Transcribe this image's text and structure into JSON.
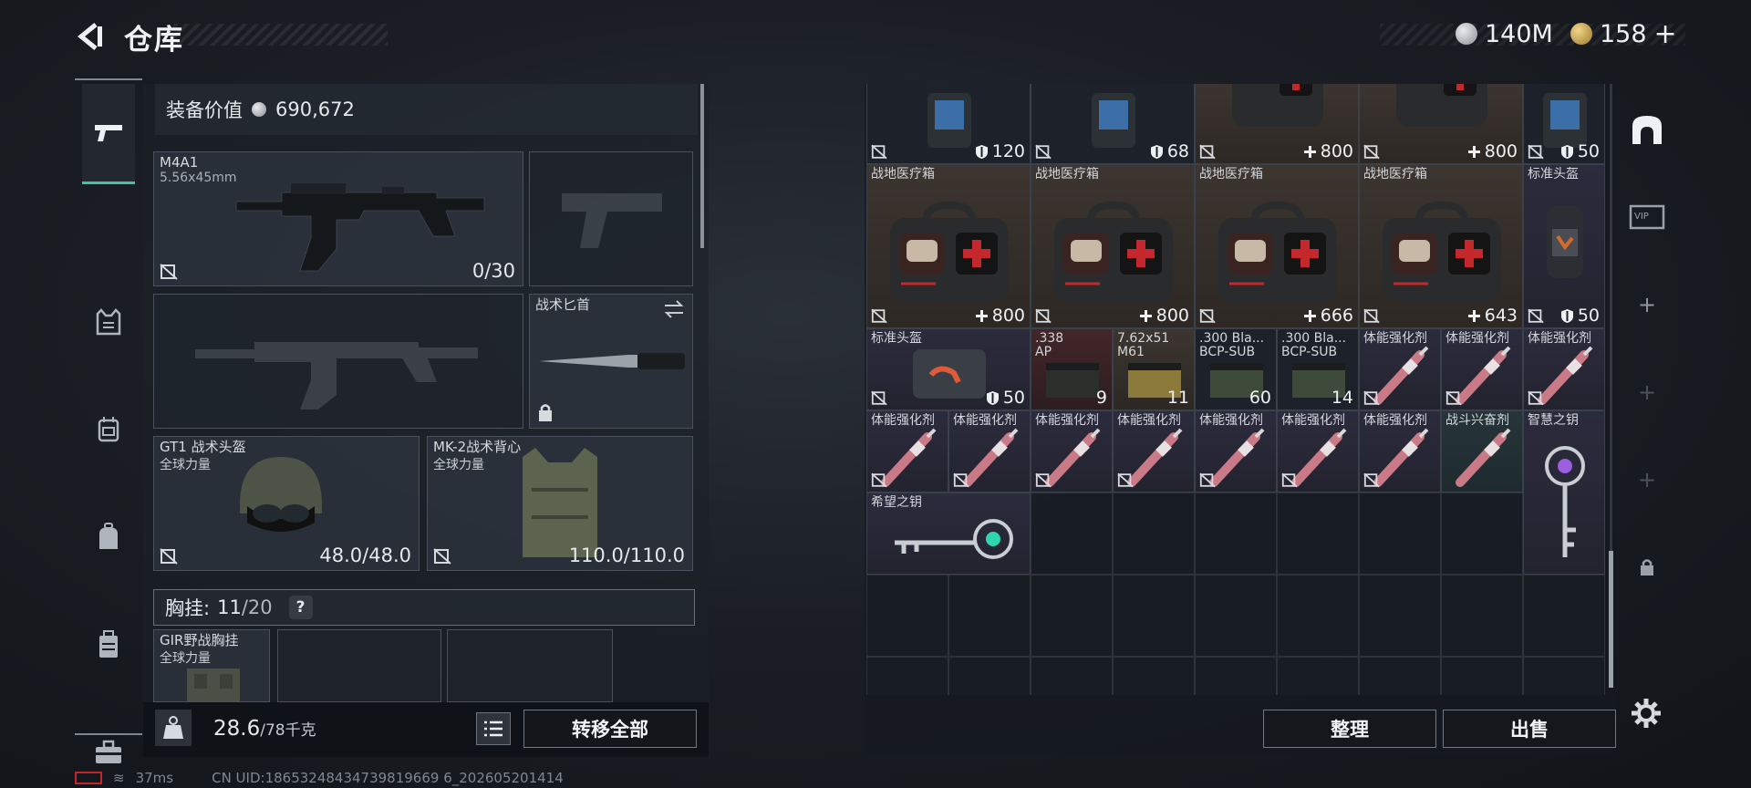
{
  "header": {
    "title": "仓库"
  },
  "currency": {
    "silver": "140M",
    "gold": "158"
  },
  "equip": {
    "value_label": "装备价值",
    "value": "690,672",
    "primary": {
      "name": "M4A1",
      "caliber": "5.56x45mm",
      "ammo": "0/30"
    },
    "melee": {
      "name": "战术匕首"
    },
    "helmet": {
      "name": "GT1 战术头盔",
      "brand": "全球力量",
      "durability": "48.0/48.0"
    },
    "armor": {
      "name": "MK-2战术背心",
      "brand": "全球力量",
      "durability": "110.0/110.0"
    },
    "chest_label": "胸挂:",
    "chest_used": "11",
    "chest_total": "/20",
    "chest_help": "?",
    "rig": {
      "name": "GIR野战胸挂",
      "brand": "全球力量"
    }
  },
  "weight": {
    "current": "28.6",
    "max": "/78千克"
  },
  "buttons": {
    "transfer_all": "转移全部",
    "sort": "整理",
    "sell": "出售"
  },
  "status": {
    "ping": "37ms",
    "uid": "CN UID:18653248434739819669 6_202605201414"
  },
  "stash": {
    "top_row": [
      {
        "value": "120",
        "icon": "armor-icon"
      },
      {
        "value": "68",
        "icon": "armor-icon"
      },
      {
        "value": "800",
        "icon": "plus-icon"
      },
      {
        "value": "800",
        "icon": "plus-icon"
      },
      {
        "value": "50",
        "icon": "armor-icon"
      }
    ],
    "medkits": [
      {
        "name": "战地医疗箱",
        "value": "800"
      },
      {
        "name": "战地医疗箱",
        "value": "800"
      },
      {
        "name": "战地医疗箱",
        "value": "666"
      },
      {
        "name": "战地医疗箱",
        "value": "643"
      }
    ],
    "helmet_tall": {
      "name": "标准头盔",
      "value": "50"
    },
    "row3": [
      {
        "name": "标准头盔",
        "value": "50"
      },
      {
        "name": ".338",
        "name2": "AP",
        "value": "9"
      },
      {
        "name": "7.62x51",
        "name2": "M61",
        "value": "11"
      },
      {
        "name": ".300 Bla...",
        "name2": "BCP-SUB",
        "value": "60"
      },
      {
        "name": ".300 Bla...",
        "name2": "BCP-SUB",
        "value": "14"
      },
      {
        "name": "体能强化剂"
      },
      {
        "name": "体能强化剂"
      },
      {
        "name": "体能强化剂"
      }
    ],
    "row4": [
      {
        "name": "体能强化剂"
      },
      {
        "name": "体能强化剂"
      },
      {
        "name": "体能强化剂"
      },
      {
        "name": "体能强化剂"
      },
      {
        "name": "体能强化剂"
      },
      {
        "name": "体能强化剂"
      },
      {
        "name": "体能强化剂"
      },
      {
        "name": "战斗兴奋剂"
      }
    ],
    "key_wisdom": {
      "name": "智慧之钥"
    },
    "key_hope": {
      "name": "希望之钥"
    }
  },
  "colors": {
    "accent": "#3ec6a0",
    "medkit_red": "#c4272c",
    "panel": "#1e242b"
  }
}
